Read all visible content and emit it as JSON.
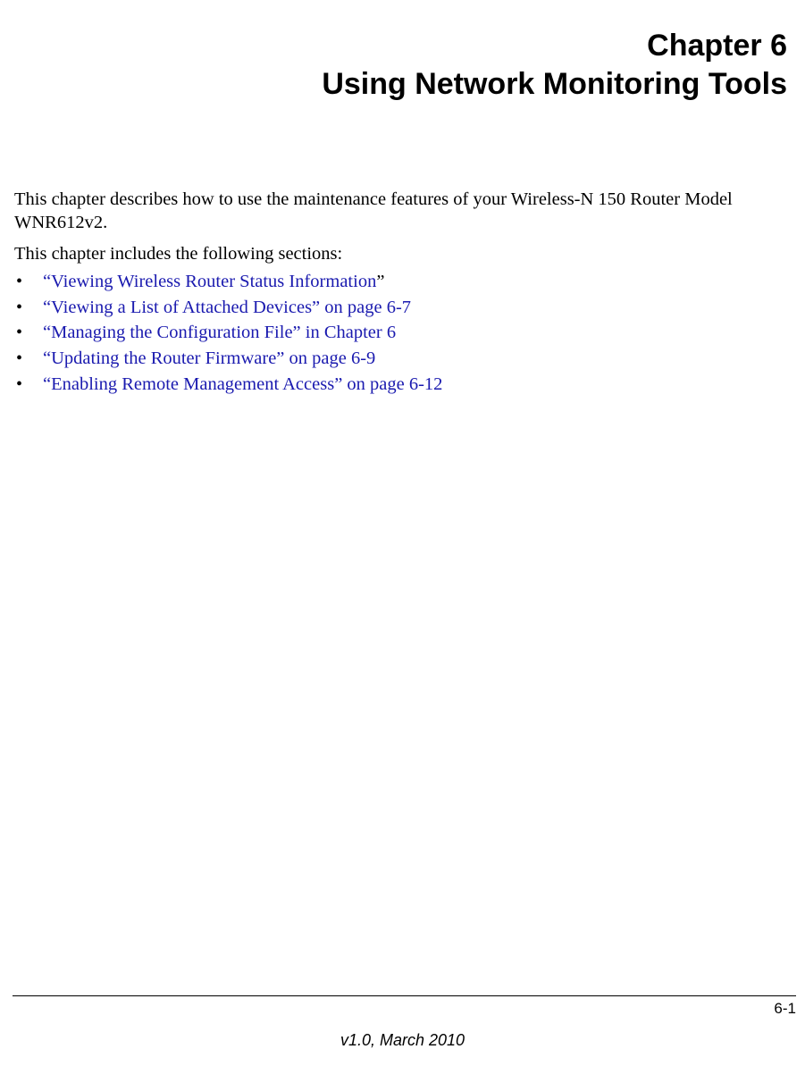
{
  "heading": {
    "line1": "Chapter 6",
    "line2": "Using Network Monitoring Tools"
  },
  "intro": "This chapter describes how to use the maintenance features of your Wireless-N 150 Router Model WNR612v2.",
  "lead": "This chapter includes the following sections:",
  "items": [
    {
      "prefix": "",
      "link": "“Viewing Wireless Router Status Information",
      "suffix": "”"
    },
    {
      "prefix": "",
      "link": "“Viewing a List of Attached Devices” on page 6-7",
      "suffix": ""
    },
    {
      "prefix": "",
      "link": "“Managing the Configuration File” in Chapter 6",
      "suffix": ""
    },
    {
      "prefix": "",
      "link": "“Updating the Router Firmware” on page 6-9",
      "suffix": ""
    },
    {
      "prefix": "",
      "link": "“Enabling Remote Management Access” on page 6-12",
      "suffix": ""
    }
  ],
  "footer": {
    "page": "6-1",
    "version": "v1.0, March 2010"
  }
}
